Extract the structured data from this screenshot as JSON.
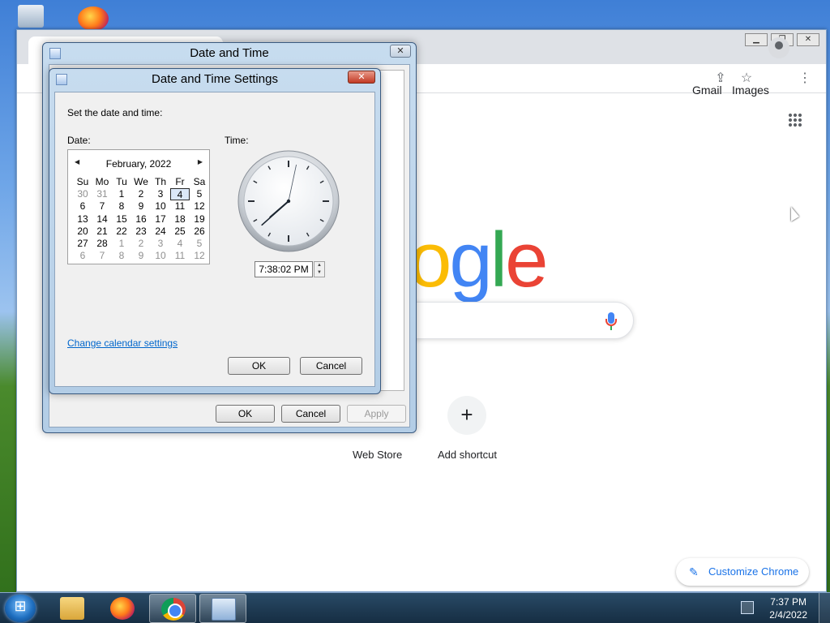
{
  "chrome": {
    "top_links": [
      "Gmail",
      "Images"
    ],
    "logo_letters": [
      {
        "char": "o",
        "color": "#fbbc05"
      },
      {
        "char": "g",
        "color": "#4285f4"
      },
      {
        "char": "l",
        "color": "#34a853"
      },
      {
        "char": "e",
        "color": "#ea4335"
      }
    ],
    "shortcuts": [
      "Web Store",
      "Add shortcut"
    ],
    "add_shortcut_symbol": "+",
    "customize_label": "Customize Chrome"
  },
  "outer_dialog": {
    "title": "Date and Time",
    "buttons": {
      "ok": "OK",
      "cancel": "Cancel",
      "apply": "Apply"
    }
  },
  "settings_dialog": {
    "title": "Date and Time Settings",
    "instruction": "Set the date and time:",
    "date_label": "Date:",
    "time_label": "Time:",
    "calendar": {
      "month": "February, 2022",
      "day_headers": [
        "Su",
        "Mo",
        "Tu",
        "We",
        "Th",
        "Fr",
        "Sa"
      ],
      "weeks": [
        [
          "30",
          "31",
          "1",
          "2",
          "3",
          "4",
          "5"
        ],
        [
          "6",
          "7",
          "8",
          "9",
          "10",
          "11",
          "12"
        ],
        [
          "13",
          "14",
          "15",
          "16",
          "17",
          "18",
          "19"
        ],
        [
          "20",
          "21",
          "22",
          "23",
          "24",
          "25",
          "26"
        ],
        [
          "27",
          "28",
          "1",
          "2",
          "3",
          "4",
          "5"
        ],
        [
          "6",
          "7",
          "8",
          "9",
          "10",
          "11",
          "12"
        ]
      ],
      "selected_day": "4"
    },
    "clock_time": {
      "hour": 7,
      "minute": 38,
      "second": 2
    },
    "time_value": "7:38:02 PM",
    "change_calendar_link": "Change calendar settings",
    "buttons": {
      "ok": "OK",
      "cancel": "Cancel"
    }
  },
  "taskbar": {
    "time": "7:37 PM",
    "date": "2/4/2022"
  }
}
